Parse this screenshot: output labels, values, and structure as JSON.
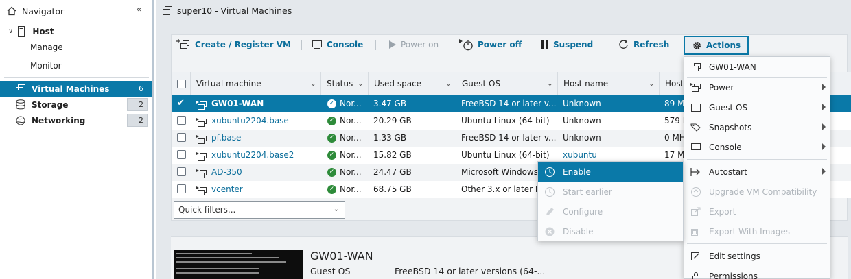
{
  "navigator": {
    "title": "Navigator",
    "host": "Host",
    "manage": "Manage",
    "monitor": "Monitor",
    "virtual_machines": {
      "label": "Virtual Machines",
      "count": "6"
    },
    "storage": {
      "label": "Storage",
      "count": "2"
    },
    "networking": {
      "label": "Networking",
      "count": "2"
    }
  },
  "header": {
    "title": "super10 - Virtual Machines"
  },
  "toolbar": {
    "create": "Create / Register VM",
    "console": "Console",
    "power_on": "Power on",
    "power_off": "Power off",
    "suspend": "Suspend",
    "refresh": "Refresh",
    "actions": "Actions"
  },
  "table": {
    "columns": [
      "Virtual machine",
      "Status",
      "Used space",
      "Guest OS",
      "Host name",
      "Host"
    ],
    "rows": [
      {
        "name": "GW01-WAN",
        "status": "Nor...",
        "used": "3.47 GB",
        "os": "FreeBSD 14 or later v...",
        "host": "Unknown",
        "cpu": "89 M"
      },
      {
        "name": "xubuntu2204.base",
        "status": "Nor...",
        "used": "20.29 GB",
        "os": "Ubuntu Linux (64-bit)",
        "host": "Unknown",
        "cpu": "579 M"
      },
      {
        "name": "pf.base",
        "status": "Nor...",
        "used": "1.33 GB",
        "os": "FreeBSD 14 or later v...",
        "host": "Unknown",
        "cpu": "0 MH"
      },
      {
        "name": "xubuntu2204.base2",
        "status": "Nor...",
        "used": "15.82 GB",
        "os": "Ubuntu Linux (64-bit)",
        "host": "xubuntu",
        "cpu": "17 M"
      },
      {
        "name": "AD-350",
        "status": "Nor...",
        "used": "24.47 GB",
        "os": "Microsoft Windows",
        "host": "",
        "cpu": ""
      },
      {
        "name": "vcenter",
        "status": "Nor...",
        "used": "68.75 GB",
        "os": "Other 3.x or later Li",
        "host": "",
        "cpu": ""
      }
    ],
    "quick_filters": "Quick filters..."
  },
  "detail": {
    "title": "GW01-WAN",
    "guest_os_label": "Guest OS",
    "guest_os_value": "FreeBSD 14 or later versions (64-..."
  },
  "actions_menu": {
    "vm": "GW01-WAN",
    "power": "Power",
    "guest_os": "Guest OS",
    "snapshots": "Snapshots",
    "console": "Console",
    "autostart": "Autostart",
    "upgrade": "Upgrade VM Compatibility",
    "export": "Export",
    "export_images": "Export With Images",
    "edit_settings": "Edit settings",
    "permissions": "Permissions"
  },
  "autostart_menu": {
    "enable": "Enable",
    "start_earlier": "Start earlier",
    "configure": "Configure",
    "disable": "Disable"
  },
  "colors": {
    "accent": "#0a79a8",
    "ok": "#2e8b3a"
  }
}
